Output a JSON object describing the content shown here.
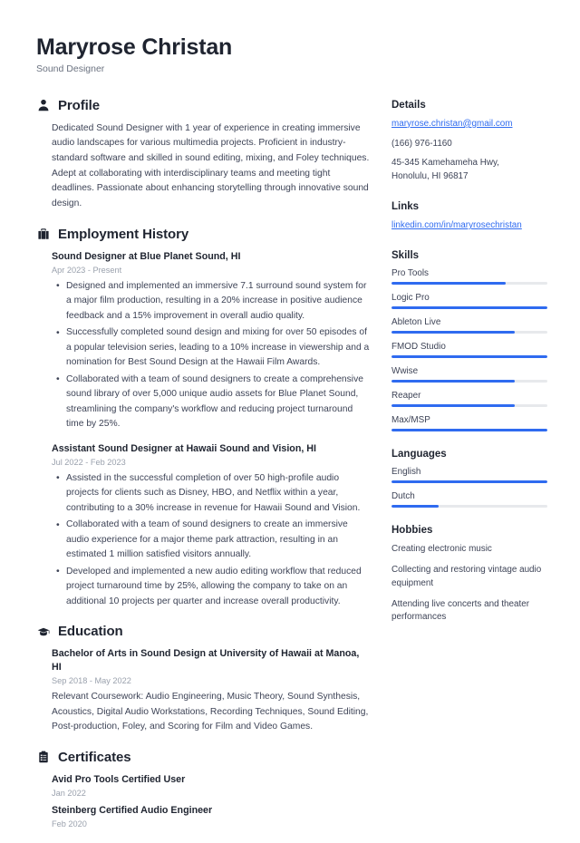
{
  "header": {
    "name": "Maryrose Christan",
    "title": "Sound Designer"
  },
  "accent_color": "#2f6bf0",
  "main": {
    "profile": {
      "heading": "Profile",
      "icon": "person-icon",
      "text": "Dedicated Sound Designer with 1 year of experience in creating immersive audio landscapes for various multimedia projects. Proficient in industry-standard software and skilled in sound editing, mixing, and Foley techniques. Adept at collaborating with interdisciplinary teams and meeting tight deadlines. Passionate about enhancing storytelling through innovative sound design."
    },
    "employment": {
      "heading": "Employment History",
      "icon": "briefcase-icon",
      "entries": [
        {
          "title": "Sound Designer at Blue Planet Sound, HI",
          "date": "Apr 2023 - Present",
          "bullets": [
            "Designed and implemented an immersive 7.1 surround sound system for a major film production, resulting in a 20% increase in positive audience feedback and a 15% improvement in overall audio quality.",
            "Successfully completed sound design and mixing for over 50 episodes of a popular television series, leading to a 10% increase in viewership and a nomination for Best Sound Design at the Hawaii Film Awards.",
            "Collaborated with a team of sound designers to create a comprehensive sound library of over 5,000 unique audio assets for Blue Planet Sound, streamlining the company's workflow and reducing project turnaround time by 25%."
          ]
        },
        {
          "title": "Assistant Sound Designer at Hawaii Sound and Vision, HI",
          "date": "Jul 2022 - Feb 2023",
          "bullets": [
            "Assisted in the successful completion of over 50 high-profile audio projects for clients such as Disney, HBO, and Netflix within a year, contributing to a 30% increase in revenue for Hawaii Sound and Vision.",
            "Collaborated with a team of sound designers to create an immersive audio experience for a major theme park attraction, resulting in an estimated 1 million satisfied visitors annually.",
            "Developed and implemented a new audio editing workflow that reduced project turnaround time by 25%, allowing the company to take on an additional 10 projects per quarter and increase overall productivity."
          ]
        }
      ]
    },
    "education": {
      "heading": "Education",
      "icon": "graduation-cap-icon",
      "entries": [
        {
          "title": "Bachelor of Arts in Sound Design at University of Hawaii at Manoa, HI",
          "date": "Sep 2018 - May 2022",
          "description": "Relevant Coursework: Audio Engineering, Music Theory, Sound Synthesis, Acoustics, Digital Audio Workstations, Recording Techniques, Sound Editing, Post-production, Foley, and Scoring for Film and Video Games."
        }
      ]
    },
    "certificates": {
      "heading": "Certificates",
      "icon": "clipboard-icon",
      "entries": [
        {
          "title": "Avid Pro Tools Certified User",
          "date": "Jan 2022"
        },
        {
          "title": "Steinberg Certified Audio Engineer",
          "date": "Feb 2020"
        }
      ]
    }
  },
  "sidebar": {
    "details": {
      "heading": "Details",
      "email": "maryrose.christan@gmail.com",
      "phone": "(166) 976-1160",
      "address_line1": "45-345 Kamehameha Hwy,",
      "address_line2": "Honolulu, HI 96817"
    },
    "links": {
      "heading": "Links",
      "items": [
        {
          "label": "linkedin.com/in/maryrosechristan"
        }
      ]
    },
    "skills": {
      "heading": "Skills",
      "items": [
        {
          "label": "Pro Tools",
          "level": 73
        },
        {
          "label": "Logic Pro",
          "level": 100
        },
        {
          "label": "Ableton Live",
          "level": 79
        },
        {
          "label": "FMOD Studio",
          "level": 100
        },
        {
          "label": "Wwise",
          "level": 79
        },
        {
          "label": "Reaper",
          "level": 79
        },
        {
          "label": "Max/MSP",
          "level": 100
        }
      ]
    },
    "languages": {
      "heading": "Languages",
      "items": [
        {
          "label": "English",
          "level": 100
        },
        {
          "label": "Dutch",
          "level": 30
        }
      ]
    },
    "hobbies": {
      "heading": "Hobbies",
      "items": [
        "Creating electronic music",
        "Collecting and restoring vintage audio equipment",
        "Attending live concerts and theater performances"
      ]
    }
  }
}
